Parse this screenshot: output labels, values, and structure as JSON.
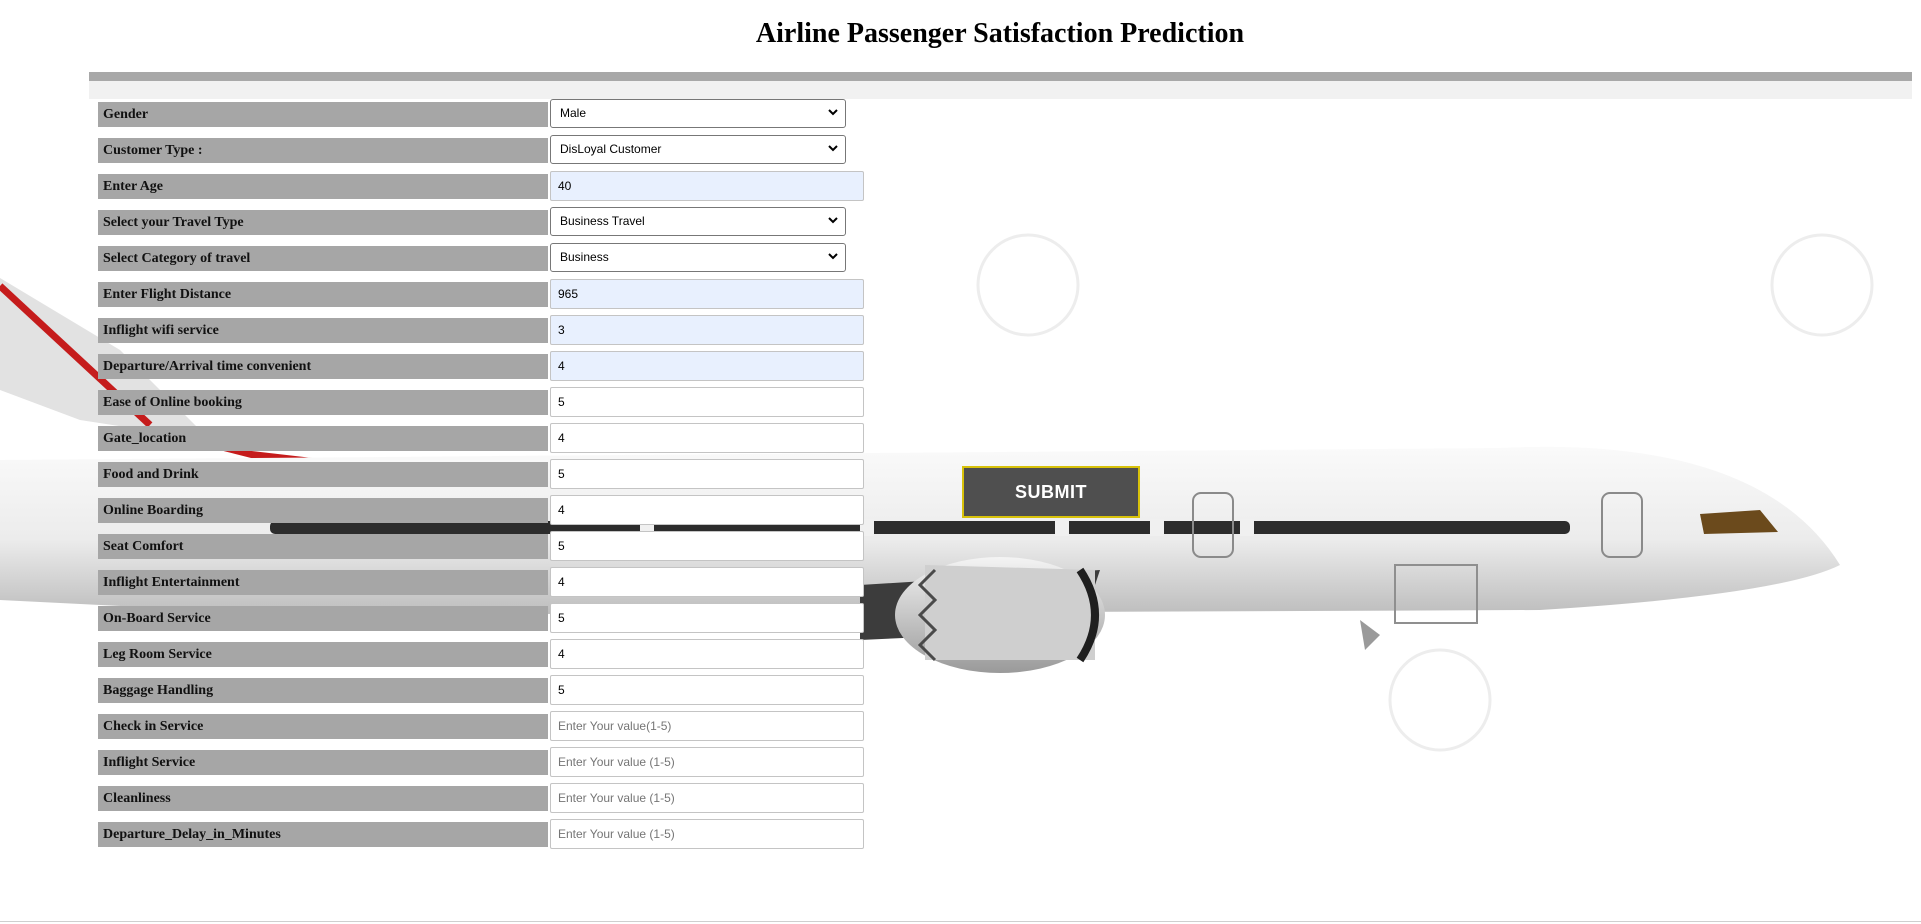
{
  "page": {
    "title": "Airline Passenger Satisfaction Prediction"
  },
  "form": {
    "gender": {
      "label": "Gender",
      "value": "Male"
    },
    "customer_type": {
      "label": "Customer Type :",
      "value": "DisLoyal Customer"
    },
    "age": {
      "label": "Enter Age",
      "value": "40"
    },
    "travel_type": {
      "label": "Select your Travel Type",
      "value": "Business Travel"
    },
    "travel_class": {
      "label": "Select Category of travel",
      "value": "Business"
    },
    "flight_distance": {
      "label": "Enter Flight Distance",
      "value": "965"
    },
    "inflight_wifi": {
      "label": "Inflight wifi service",
      "value": "3"
    },
    "time_convenient": {
      "label": "Departure/Arrival time convenient",
      "value": "4"
    },
    "online_booking": {
      "label": "Ease of Online booking",
      "value": "5"
    },
    "gate_location": {
      "label": "Gate_location",
      "value": "4"
    },
    "food_drink": {
      "label": "Food and Drink",
      "value": "5"
    },
    "online_boarding": {
      "label": "Online Boarding",
      "value": "4"
    },
    "seat_comfort": {
      "label": "Seat Comfort",
      "value": "5"
    },
    "entertainment": {
      "label": "Inflight Entertainment",
      "value": "4"
    },
    "onboard_service": {
      "label": "On-Board Service",
      "value": "5"
    },
    "leg_room": {
      "label": "Leg Room Service",
      "value": "4"
    },
    "baggage": {
      "label": "Baggage Handling",
      "value": "5"
    },
    "checkin": {
      "label": "Check in Service",
      "placeholder": "Enter Your value(1-5)"
    },
    "inflight_service": {
      "label": "Inflight Service",
      "placeholder": "Enter Your value (1-5)"
    },
    "cleanliness": {
      "label": "Cleanliness",
      "placeholder": "Enter Your value (1-5)"
    },
    "departure_delay": {
      "label": "Departure_Delay_in_Minutes",
      "placeholder": "Enter Your value (1-5)"
    }
  },
  "submit": {
    "label": "SUBMIT"
  },
  "colors": {
    "label_bg": "#a6a6a6",
    "autofill_bg": "#e8f0fe",
    "submit_bg": "#4f4f4f",
    "submit_border": "#d8c20a"
  },
  "icons": {
    "select_arrow": "chevron-down-icon",
    "background": "airplane-image"
  }
}
